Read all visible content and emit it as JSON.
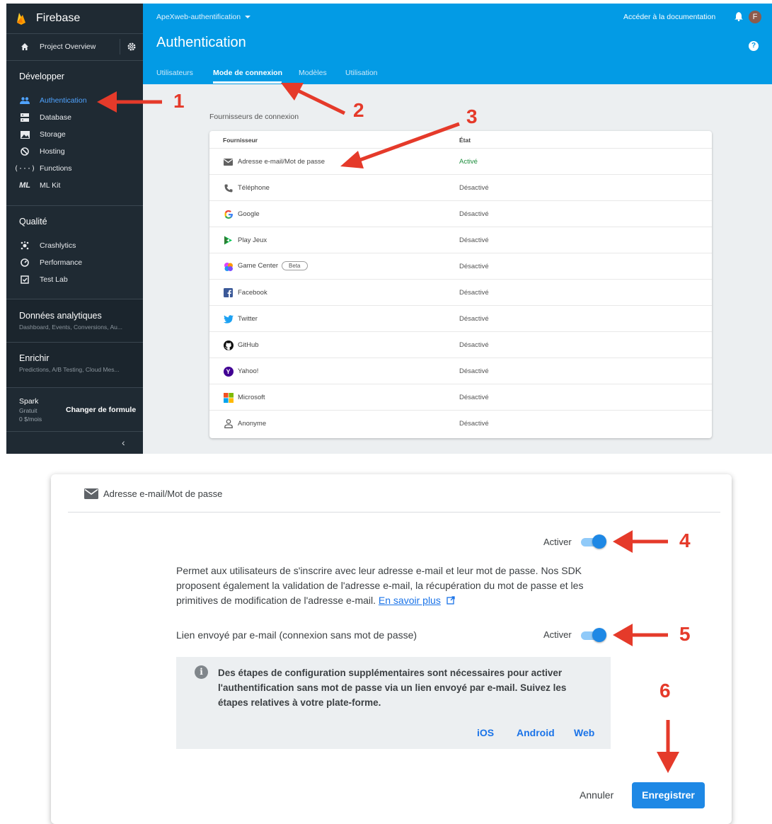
{
  "sidebar": {
    "brand": "Firebase",
    "project_overview": "Project Overview",
    "sections": [
      {
        "title": "Développer"
      },
      {
        "title": "Qualité"
      },
      {
        "title": "Données analytiques",
        "subtitle": "Dashboard, Events, Conversions, Au..."
      },
      {
        "title": "Enrichir",
        "subtitle": "Predictions, A/B Testing, Cloud Mes..."
      }
    ],
    "develop_items": [
      "Authentication",
      "Database",
      "Storage",
      "Hosting",
      "Functions",
      "ML Kit"
    ],
    "quality_items": [
      "Crashlytics",
      "Performance",
      "Test Lab"
    ],
    "plan": {
      "name": "Spark",
      "tier": "Gratuit",
      "price": "0 $/mois",
      "change_label": "Changer de formule"
    },
    "collapse_glyph": "‹"
  },
  "header": {
    "project_name": "ApeXweb-authentification",
    "page_title": "Authentication",
    "docs_link": "Accéder à la documentation",
    "avatar_letter": "F",
    "tabs": [
      "Utilisateurs",
      "Mode de connexion",
      "Modèles",
      "Utilisation"
    ],
    "active_tab": "Mode de connexion"
  },
  "providers": {
    "section_title": "Fournisseurs de connexion",
    "col_provider": "Fournisseur",
    "col_state": "État",
    "rows": [
      {
        "name": "Adresse e-mail/Mot de passe",
        "state": "Activé",
        "icon": "email-icon"
      },
      {
        "name": "Téléphone",
        "state": "Désactivé",
        "icon": "phone-icon"
      },
      {
        "name": "Google",
        "state": "Désactivé",
        "icon": "google-icon"
      },
      {
        "name": "Play Jeux",
        "state": "Désactivé",
        "icon": "play-games-icon"
      },
      {
        "name": "Game Center",
        "state": "Désactivé",
        "icon": "game-center-icon",
        "badge": "Beta"
      },
      {
        "name": "Facebook",
        "state": "Désactivé",
        "icon": "facebook-icon"
      },
      {
        "name": "Twitter",
        "state": "Désactivé",
        "icon": "twitter-icon"
      },
      {
        "name": "GitHub",
        "state": "Désactivé",
        "icon": "github-icon"
      },
      {
        "name": "Yahoo!",
        "state": "Désactivé",
        "icon": "yahoo-icon"
      },
      {
        "name": "Microsoft",
        "state": "Désactivé",
        "icon": "microsoft-icon"
      },
      {
        "name": "Anonyme",
        "state": "Désactivé",
        "icon": "anonymous-icon"
      }
    ]
  },
  "dialog": {
    "title": "Adresse e-mail/Mot de passe",
    "enable_label": "Activer",
    "enable_on": true,
    "description": "Permet aux utilisateurs de s'inscrire avec leur adresse e-mail et leur mot de passe. Nos SDK proposent également la validation de l'adresse e-mail, la récupération du mot de passe et les primitives de modification de l'adresse e-mail.",
    "learn_more": "En savoir plus",
    "email_link_label": "Lien envoyé par e-mail (connexion sans mot de passe)",
    "email_link_enable_label": "Activer",
    "email_link_on": true,
    "info_text": "Des étapes de configuration supplémentaires sont nécessaires pour activer l'authentification sans mot de passe via un lien envoyé par e-mail. Suivez les étapes relatives à votre plate-forme.",
    "platforms": [
      "iOS",
      "Android",
      "Web"
    ],
    "cancel_label": "Annuler",
    "save_label": "Enregistrer"
  },
  "annotations": [
    "1",
    "2",
    "3",
    "4",
    "5",
    "6"
  ],
  "colors": {
    "accent": "#039be5",
    "sidebar": "#1f2a33",
    "annotation": "#e53a2a",
    "button": "#1e88e5"
  }
}
